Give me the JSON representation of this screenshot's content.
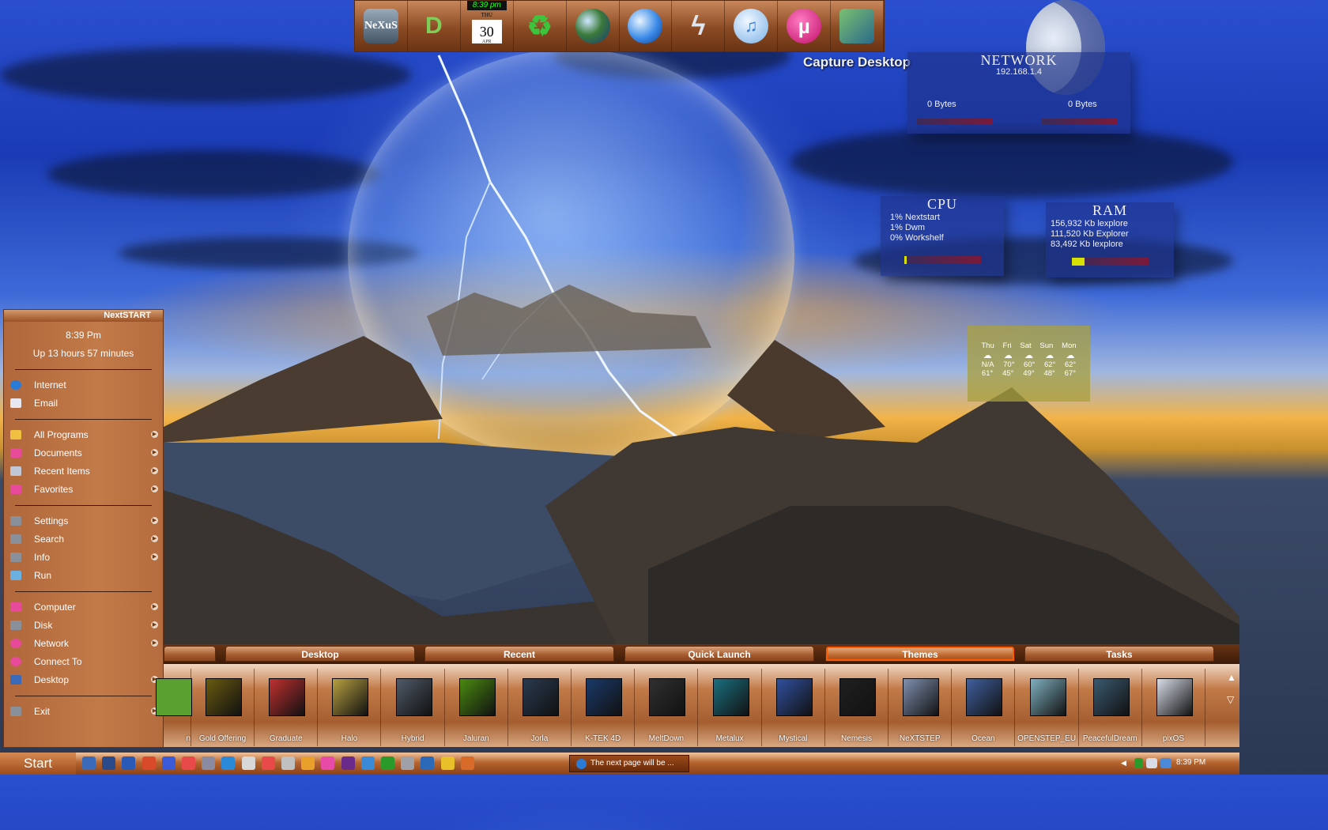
{
  "dock": {
    "items": [
      {
        "name": "nexus-icon",
        "label": "NeXuS"
      },
      {
        "name": "d-icon",
        "label": "D"
      },
      {
        "name": "calendar-icon",
        "label": ""
      },
      {
        "name": "recycle-bin-icon",
        "label": "♻"
      },
      {
        "name": "earth-globe-icon",
        "label": ""
      },
      {
        "name": "internet-globe-icon",
        "label": ""
      },
      {
        "name": "lightning-icon",
        "label": "ϟ"
      },
      {
        "name": "itunes-icon",
        "label": "♫"
      },
      {
        "name": "utorrent-icon",
        "label": "µ"
      },
      {
        "name": "gear-app-icon",
        "label": ""
      }
    ],
    "clock": "8:39 pm",
    "calendar_dow": "THU",
    "calendar_day": "30",
    "calendar_month": "APR"
  },
  "capture_desktop": "Capture Desktop",
  "network": {
    "title": "NETWORK",
    "ip": "192.168.1.4",
    "down": "0 Bytes",
    "up": "0 Bytes"
  },
  "cpu": {
    "title": "CPU",
    "lines": [
      "1% Nextstart",
      "1% Dwm",
      "0% Workshelf"
    ],
    "usage": 0.03
  },
  "ram": {
    "title": "RAM",
    "lines": [
      "156,932 Kb lexplore",
      "111,520 Kb Explorer",
      "83,492 Kb lexplore"
    ],
    "usage": 0.17
  },
  "weather": {
    "days": [
      "Thu",
      "Fri",
      "Sat",
      "Sun",
      "Mon"
    ],
    "highs": [
      "N/A",
      "70°",
      "60°",
      "62°",
      "62°"
    ],
    "lows": [
      "61°",
      "45°",
      "49°",
      "48°",
      "67°"
    ]
  },
  "startmenu": {
    "title": "NextSTART",
    "time": "8:39 Pm",
    "uptime": "Up 13 hours 57 minutes",
    "group1": [
      "Internet",
      "Email"
    ],
    "group2": [
      "All Programs",
      "Documents",
      "Recent Items",
      "Favorites"
    ],
    "group3": [
      "Settings",
      "Search",
      "Info",
      "Run"
    ],
    "group4": [
      "Computer",
      "Disk",
      "Network",
      "Connect To",
      "Desktop"
    ],
    "exit": "Exit"
  },
  "shelf": {
    "tabs": [
      "Desktop",
      "Recent",
      "Quick Launch",
      "Themes",
      "Tasks"
    ],
    "active_tab": "Themes",
    "first_label": "n",
    "themes": [
      "Gold Offering",
      "Graduate",
      "Halo",
      "Hybrid",
      "Jaluran",
      "Jorla",
      "K-TEK 4D",
      "MeltDown",
      "Metalux",
      "Mystical",
      "Nemesis",
      "NeXTSTEP",
      "Ocean",
      "OPENSTEP_EU",
      "PeacefulDream",
      "pixOS"
    ],
    "theme_colors": [
      "#6a5a10",
      "#c03030",
      "#b8a040",
      "#505a68",
      "#4a8a10",
      "#2a3a50",
      "#1a3a6a",
      "#303030",
      "#1a7080",
      "#3050a0",
      "#202020",
      "#8090b0",
      "#4060a0",
      "#80b0c0",
      "#3a5a70",
      "#d8dde8"
    ]
  },
  "taskbar": {
    "start": "Start",
    "task": "The next page will be ...",
    "time": "8:39 PM"
  }
}
